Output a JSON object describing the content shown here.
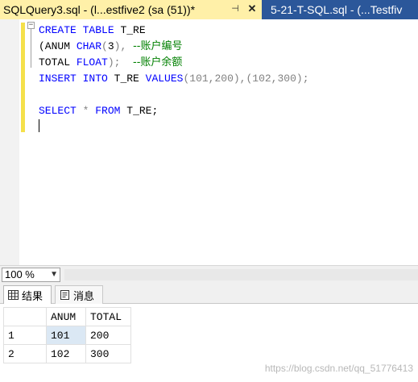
{
  "tabs": {
    "active_title": "SQLQuery3.sql - (l...estfive2 (sa (51))*",
    "inactive_title": "5-21-T-SQL.sql - (...Testfiv"
  },
  "editor": {
    "lines": [
      [
        "CREATE",
        " ",
        "TABLE",
        " T_RE"
      ],
      [
        "(ANUM ",
        "CHAR",
        "(",
        "3",
        "),",
        " ",
        "--账户编号"
      ],
      [
        "TOTAL ",
        "FLOAT",
        ");",
        "  ",
        "--账户余额"
      ],
      [
        "INSERT",
        " ",
        "INTO",
        " T_RE ",
        "VALUES",
        "(101,200),(102,300);"
      ],
      [
        ""
      ],
      [
        "SELECT",
        " ",
        "*",
        " ",
        "FROM",
        " T_RE;"
      ]
    ],
    "outline_marker": "−"
  },
  "zoom": {
    "value": "100 %"
  },
  "results_tabs": {
    "results": "结果",
    "messages": "消息"
  },
  "grid": {
    "columns": [
      "ANUM",
      "TOTAL"
    ],
    "rows": [
      {
        "num": "1",
        "anum": "101",
        "total": "200"
      },
      {
        "num": "2",
        "anum": "102",
        "total": "300"
      }
    ]
  },
  "watermark": "https://blog.csdn.net/qq_51776413",
  "colors": {
    "tab_active": "#fff0a8",
    "tab_strip": "#2b579a",
    "keyword": "#0000ff",
    "comment": "#008000"
  },
  "icons": {
    "pin": "pin-icon",
    "close": "close-icon",
    "grid": "grid-icon",
    "messages": "doc-icon",
    "zoom_dropdown": "chevron-down-icon"
  }
}
